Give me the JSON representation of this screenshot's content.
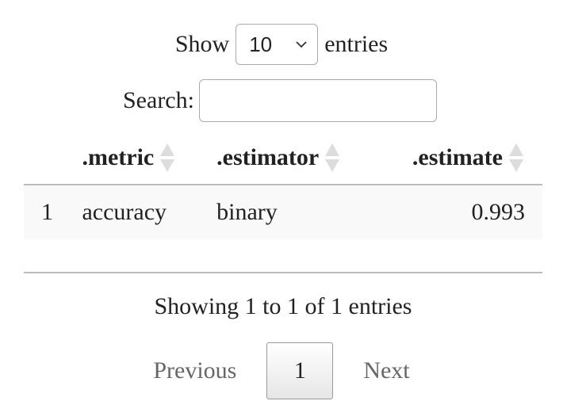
{
  "length_control": {
    "prefix": "Show",
    "selected": "10",
    "suffix": "entries"
  },
  "search": {
    "label": "Search:",
    "value": ""
  },
  "table": {
    "columns": [
      {
        "label": ""
      },
      {
        "label": ".metric"
      },
      {
        "label": ".estimator"
      },
      {
        "label": ".estimate"
      }
    ],
    "rows": [
      {
        "index": "1",
        "metric": "accuracy",
        "estimator": "binary",
        "estimate": "0.993"
      }
    ]
  },
  "info": "Showing 1 to 1 of 1 entries",
  "pagination": {
    "previous": "Previous",
    "current": "1",
    "next": "Next"
  }
}
